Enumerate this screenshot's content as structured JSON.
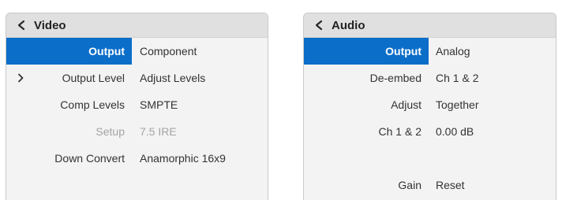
{
  "video_panel": {
    "title": "Video",
    "rows": [
      {
        "label": "Output",
        "value": "Component"
      },
      {
        "label": "Output Level",
        "value": "Adjust Levels"
      },
      {
        "label": "Comp Levels",
        "value": "SMPTE"
      },
      {
        "label": "Setup",
        "value": "7.5 IRE"
      },
      {
        "label": "Down Convert",
        "value": "Anamorphic 16x9"
      }
    ]
  },
  "audio_panel": {
    "title": "Audio",
    "rows": [
      {
        "label": "Output",
        "value": "Analog"
      },
      {
        "label": "De-embed",
        "value": "Ch 1 & 2"
      },
      {
        "label": "Adjust",
        "value": "Together"
      },
      {
        "label": "Ch 1 & 2",
        "value": "0.00 dB"
      },
      {
        "label": "Gain",
        "value": "Reset"
      }
    ]
  },
  "colors": {
    "selection": "#0b6ec9",
    "header_background": "#e0e0e0",
    "panel_background": "#f3f3f3",
    "disabled_text": "#a4a4a4"
  },
  "icons": {
    "back": "chevron-left-icon",
    "submenu": "chevron-right-icon"
  }
}
